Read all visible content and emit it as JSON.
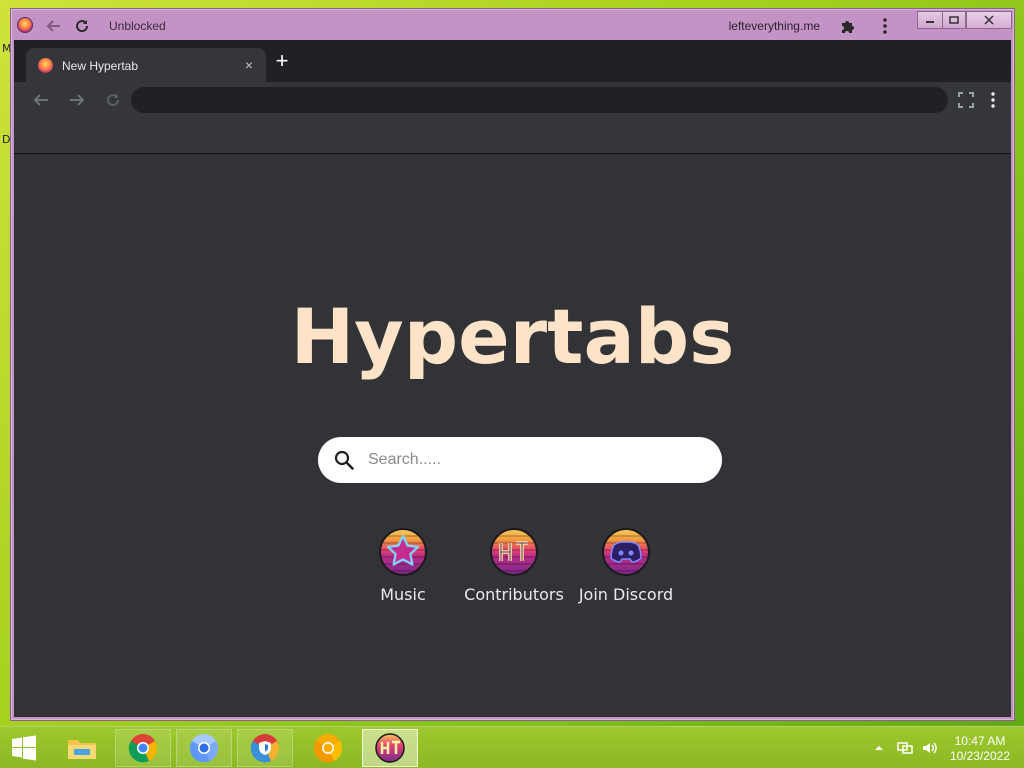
{
  "desktop": {
    "edge_fragments": [
      "M",
      "D"
    ]
  },
  "app_window": {
    "title": "Unblocked",
    "url_label": "lefteverything.me",
    "icons": {
      "favicon": "hypertabs-logo-icon",
      "back": "arrow-left-icon",
      "reload": "reload-icon",
      "extensions": "puzzle-icon",
      "menu": "vertical-dots-icon"
    },
    "controls": {
      "minimize": "minimize-icon",
      "restore": "restore-icon",
      "close": "close-icon"
    }
  },
  "browser": {
    "tabs": [
      {
        "title": "New Hypertab",
        "favicon": "hypertabs-logo-icon"
      }
    ],
    "new_tab_symbol": "+",
    "tab_close_symbol": "×",
    "address_bar": {
      "value": "",
      "placeholder": ""
    },
    "toolbar_icons": [
      "arrow-left-icon",
      "arrow-right-icon",
      "reload-icon",
      "fullscreen-icon",
      "vertical-dots-icon"
    ]
  },
  "page": {
    "title": "Hypertabs",
    "search": {
      "placeholder": "Search....."
    },
    "shortcuts": [
      {
        "label": "Music",
        "icon": "star-icon"
      },
      {
        "label": "Contributors",
        "icon": "ht-logo-icon"
      },
      {
        "label": "Join Discord",
        "icon": "discord-icon"
      }
    ],
    "colors": {
      "title": "#fde3c8",
      "background": "#323336",
      "tabstrip": "#202124"
    }
  },
  "taskbar": {
    "apps": [
      "windows-start-icon",
      "file-explorer-icon",
      "chrome-icon",
      "chromium-icon",
      "secure-browser-icon",
      "chrome-canary-icon",
      "hypertabs-app-icon"
    ],
    "clock": {
      "time": "10:47 AM",
      "date": "10/23/2022"
    }
  }
}
